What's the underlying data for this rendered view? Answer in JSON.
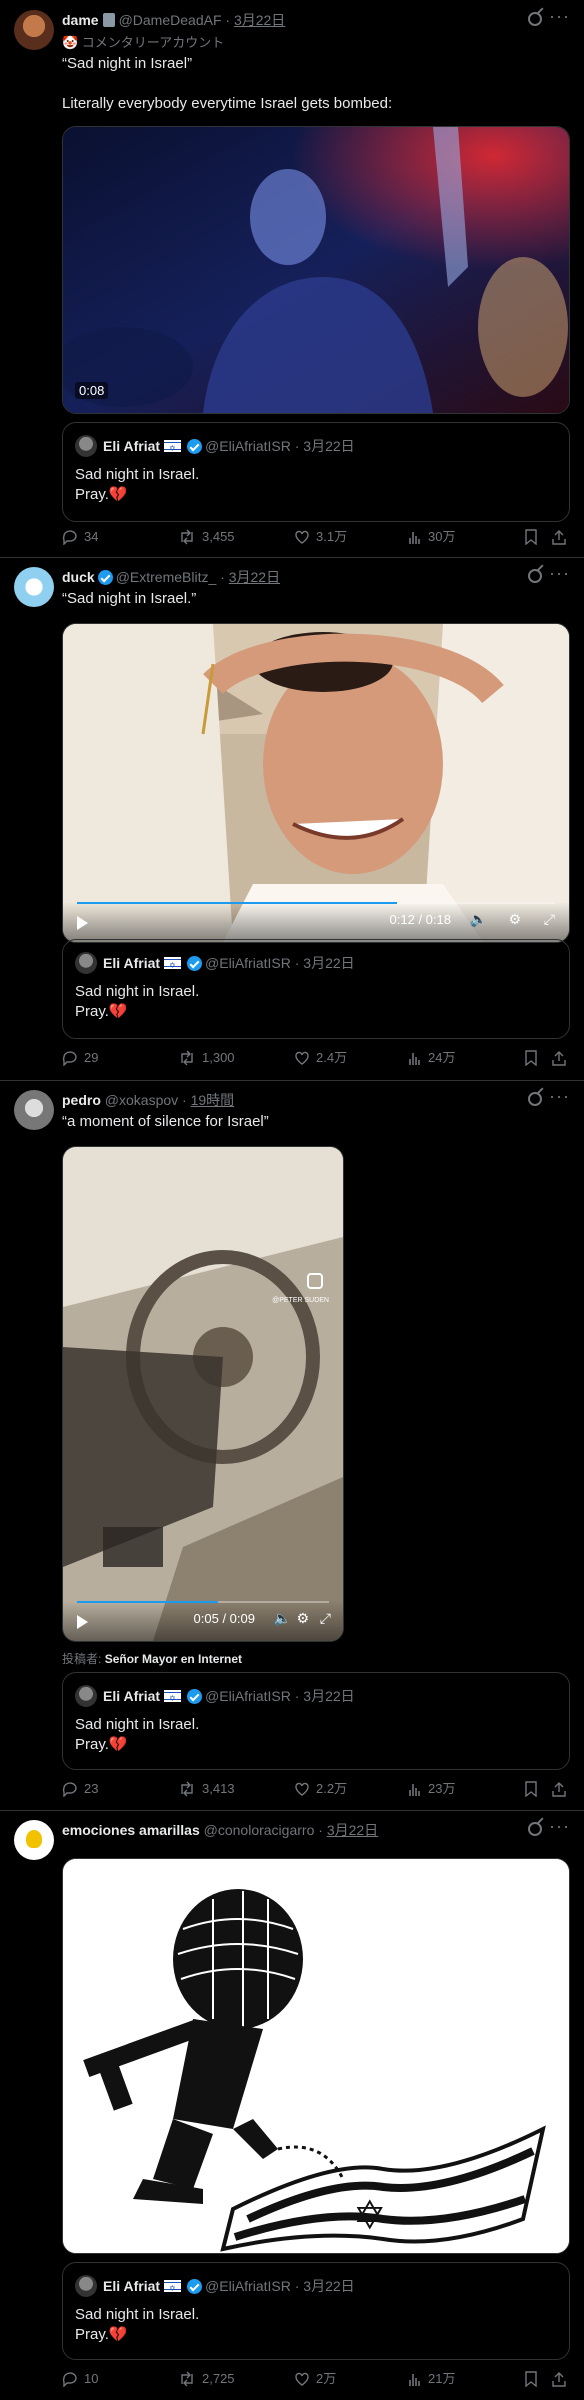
{
  "posts": [
    {
      "name": "dame",
      "handle": "@DameDeadAF",
      "date": "3月22日",
      "sub": "🤡 コメンタリーアカウント",
      "text": "“Sad night in Israel”\n\nLiterally everybody everytime Israel gets bombed:",
      "video_duration": "0:08",
      "quote": {
        "name": "Eli Afriat",
        "handle": "@EliAfriatISR",
        "date": "3月22日",
        "line1": "Sad night in Israel.",
        "line2": "Pray.",
        "emoji": "💔"
      },
      "stats": {
        "replies": "34",
        "reposts": "3,455",
        "likes": "3.1万",
        "views": "30万"
      }
    },
    {
      "name": "duck",
      "handle": "@ExtremeBlitz_",
      "date": "3月22日",
      "text": "“Sad night in Israel.”",
      "video_time": "0:12 / 0:18",
      "video_progress": 0.67,
      "quote": {
        "name": "Eli Afriat",
        "handle": "@EliAfriatISR",
        "date": "3月22日",
        "line1": "Sad night in Israel.",
        "line2": "Pray.",
        "emoji": "💔"
      },
      "stats": {
        "replies": "29",
        "reposts": "1,300",
        "likes": "2.4万",
        "views": "24万"
      }
    },
    {
      "name": "pedro",
      "handle": "@xokaspov",
      "date": "19時間",
      "text": "“a moment of silence for Israel”",
      "video_time": "0:05 / 0:09",
      "video_progress": 0.56,
      "watermark": "@PETER SUDEN",
      "posted_by_label": "投稿者:",
      "posted_by": "Señor Mayor en Internet",
      "quote": {
        "name": "Eli Afriat",
        "handle": "@EliAfriatISR",
        "date": "3月22日",
        "line1": "Sad night in Israel.",
        "line2": "Pray.",
        "emoji": "💔"
      },
      "stats": {
        "replies": "23",
        "reposts": "3,413",
        "likes": "2.2万",
        "views": "23万"
      }
    },
    {
      "name": "emociones amarillas",
      "handle": "@conoloracigarro",
      "date": "3月22日",
      "quote": {
        "name": "Eli Afriat",
        "handle": "@EliAfriatISR",
        "date": "3月22日",
        "line1": "Sad night in Israel.",
        "line2": "Pray.",
        "emoji": "💔"
      },
      "stats": {
        "replies": "10",
        "reposts": "2,725",
        "likes": "2万",
        "views": "21万"
      }
    }
  ],
  "colors": {
    "background": "#000000",
    "text": "#e7e9ea",
    "muted": "#71767b",
    "border": "#2f3336",
    "accent": "#1d9bf0",
    "heart": "#f91880"
  },
  "icons": {
    "reply": "reply-icon",
    "repost": "repost-icon",
    "like": "like-icon",
    "views": "views-icon",
    "bookmark": "bookmark-icon",
    "share": "share-icon",
    "grok": "grok-icon",
    "more": "more-icon"
  }
}
